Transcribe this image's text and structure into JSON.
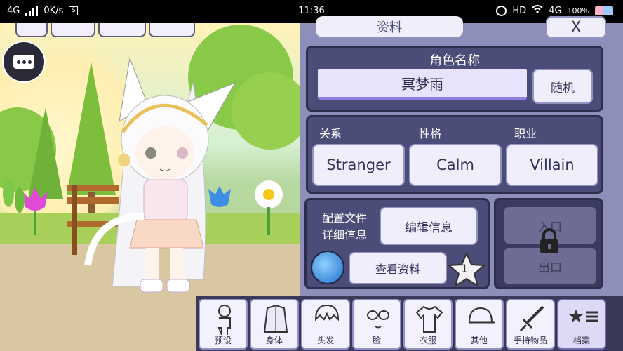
{
  "status": {
    "network": "4G",
    "speed": "0K/s",
    "time": "11:36",
    "hd": "HD",
    "net2": "4G",
    "battery": "100%"
  },
  "panel": {
    "header_title": "资料",
    "close_glyph": "X",
    "name_title": "角色名称",
    "name_value": "冥梦雨",
    "random_label": "随机",
    "relation_label": "关系",
    "personality_label": "性格",
    "occupation_label": "职业",
    "relation_value": "Stranger",
    "personality_value": "Calm",
    "occupation_value": "Villain",
    "profile_line1": "配置文件",
    "profile_line2": "详细信息",
    "edit_info_label": "编辑信息",
    "view_info_label": "查看资料",
    "star_number": "1",
    "entrance_label": "入口",
    "exit_label": "出口"
  },
  "dock": {
    "items": [
      {
        "label": "预设",
        "icon": "preset-icon"
      },
      {
        "label": "身体",
        "icon": "body-icon"
      },
      {
        "label": "头发",
        "icon": "hair-icon"
      },
      {
        "label": "脸",
        "icon": "face-icon"
      },
      {
        "label": "衣服",
        "icon": "clothes-icon"
      },
      {
        "label": "其他",
        "icon": "cap-icon"
      },
      {
        "label": "手持物品",
        "icon": "sword-icon"
      },
      {
        "label": "档案",
        "icon": "profile-icon"
      }
    ]
  },
  "colors": {
    "panel_bg": "#8d8fba",
    "card_bg": "#4c4c78",
    "button_bg": "#f1eefc",
    "dock_bg": "#3a3957"
  }
}
